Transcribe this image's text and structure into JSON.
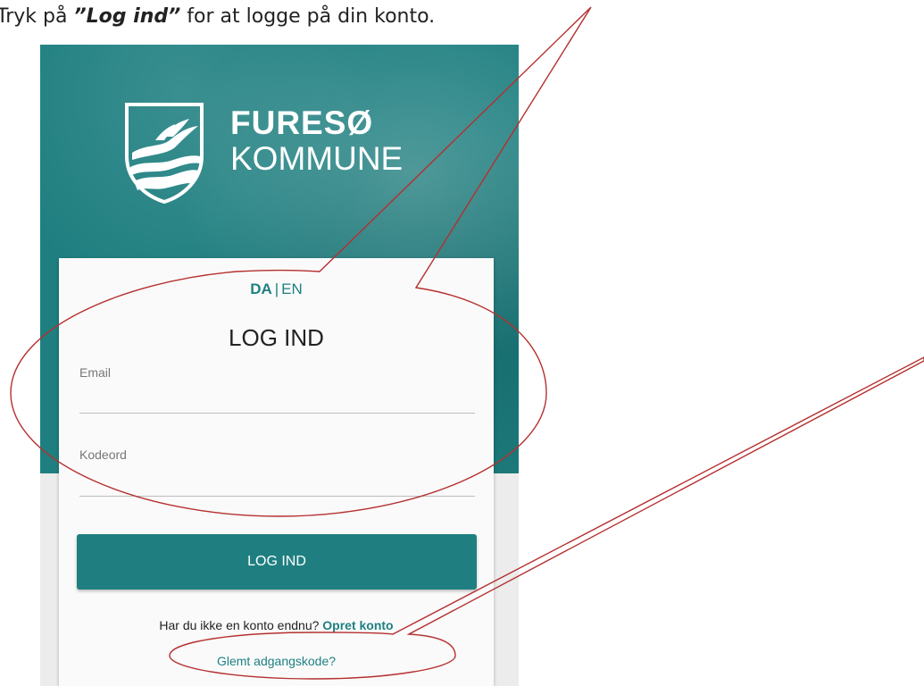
{
  "instruction": {
    "prefix": "Tryk på ",
    "emphasis": "”Log ind”",
    "suffix": " for at logge på din konto."
  },
  "brand": {
    "line1": "FURESØ",
    "line2": "KOMMUNE",
    "icon": "coat-of-arms-icon"
  },
  "language": {
    "active": "DA",
    "separator": "|",
    "other": "EN"
  },
  "login": {
    "title": "LOG IND",
    "email_label": "Email",
    "email_value": "",
    "password_label": "Kodeord",
    "password_value": "",
    "button_label": "LOG IND",
    "signup_prompt": "Har du ikke en konto endnu?",
    "signup_link": "Opret konto",
    "forgot_link": "Glemt adgangskode?"
  },
  "colors": {
    "brand_teal": "#1f7f80",
    "annotation_red": "#b5302f",
    "card_background": "#fafafa"
  }
}
